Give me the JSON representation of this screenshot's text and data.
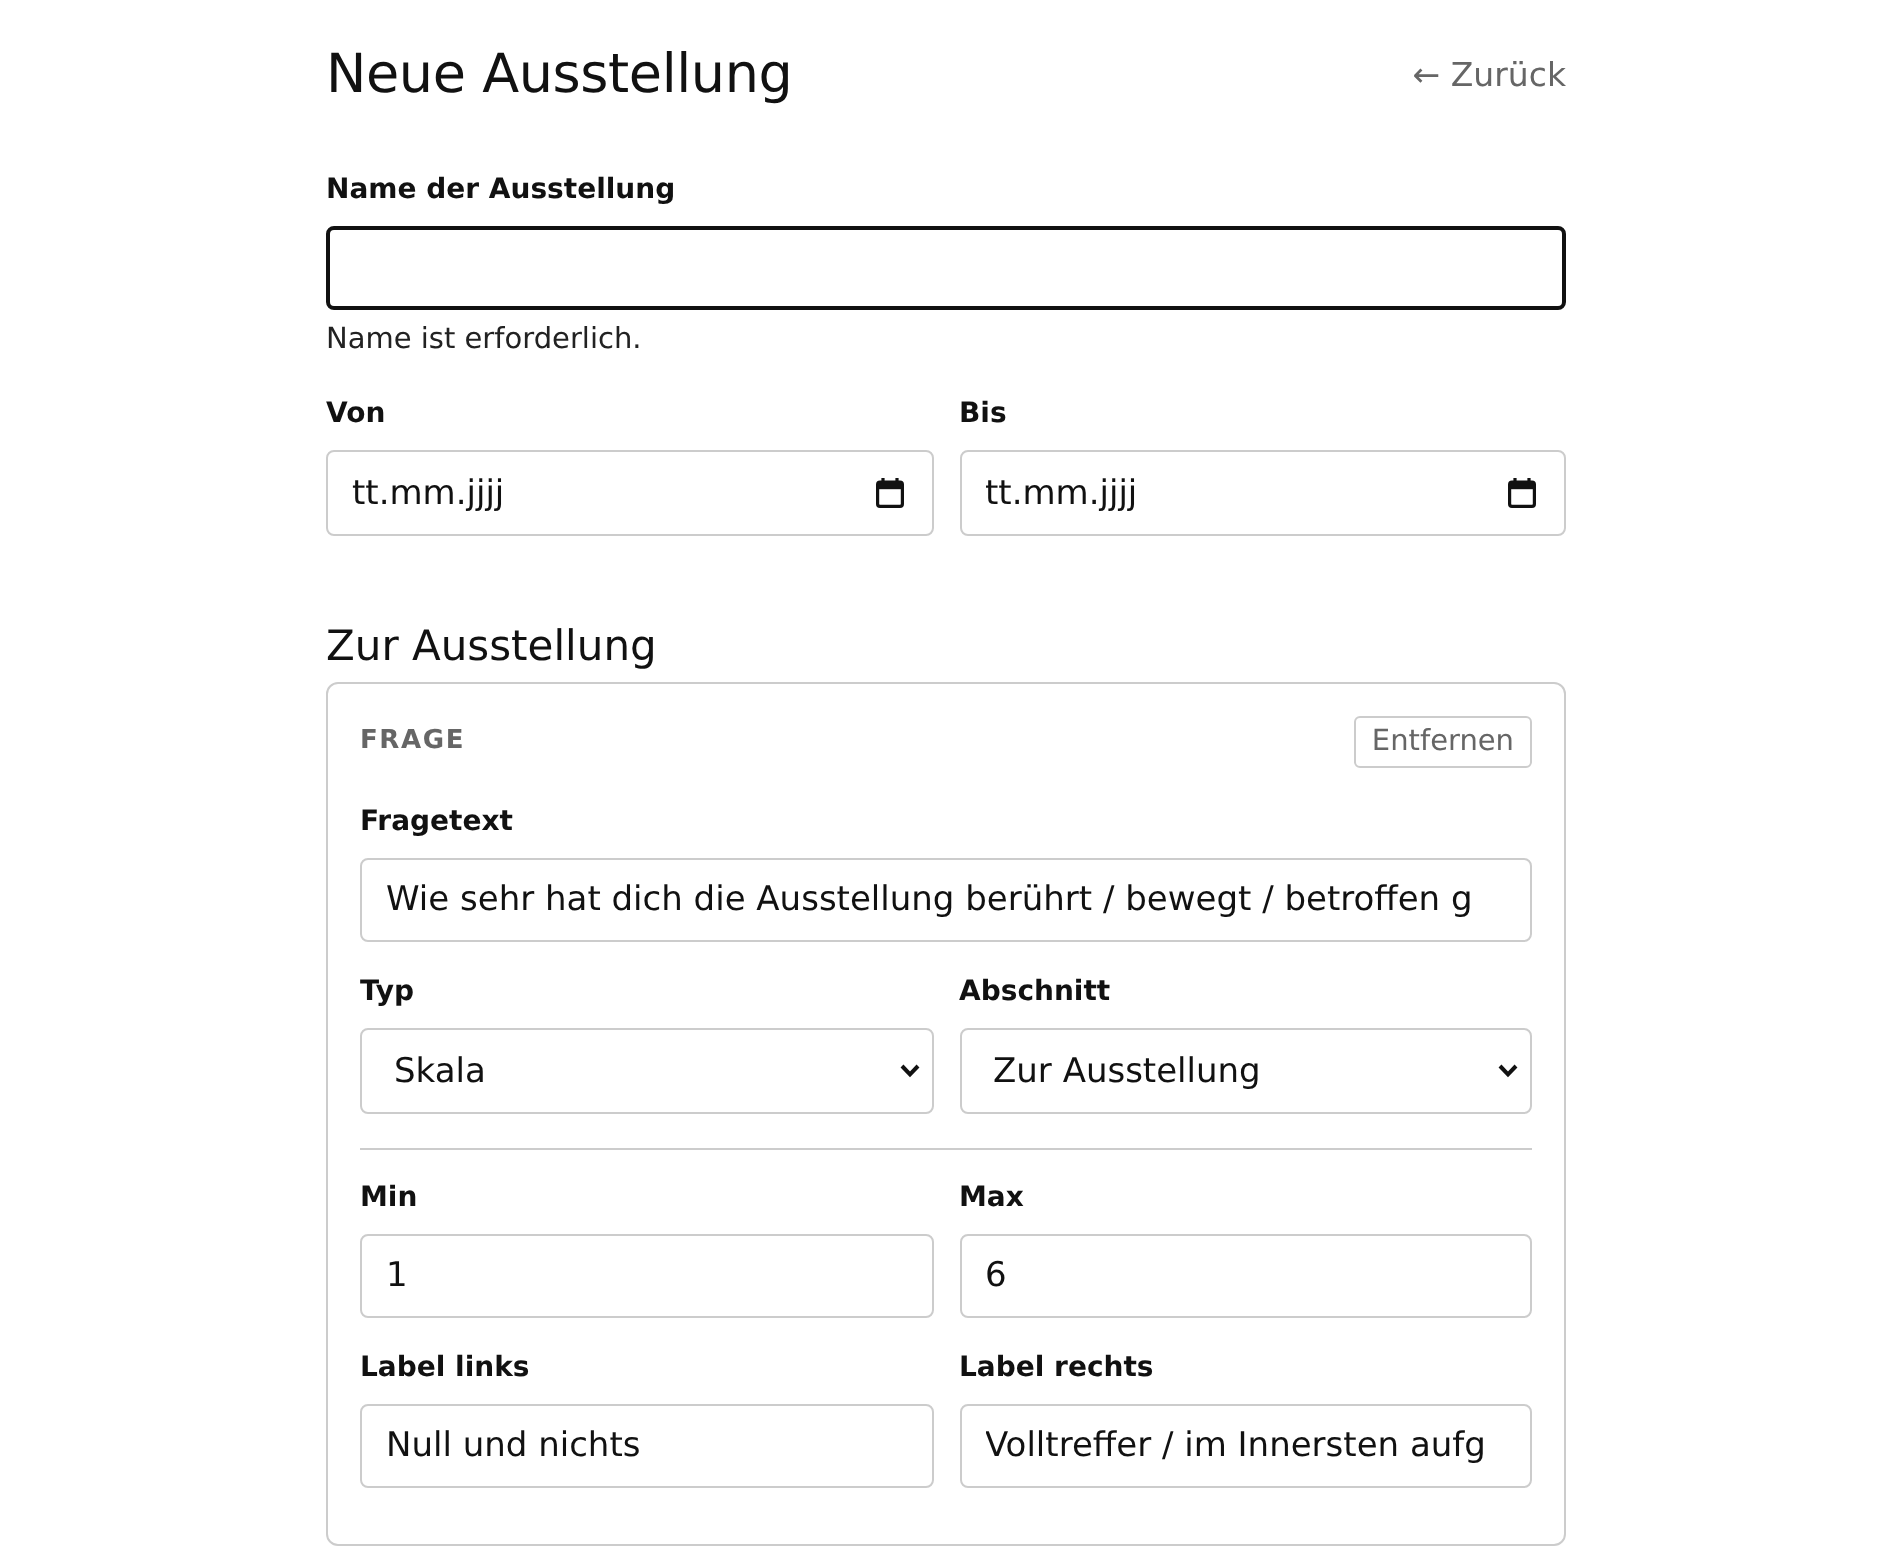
{
  "header": {
    "title": "Neue Ausstellung",
    "back_link": "← Zurück"
  },
  "name_field": {
    "label": "Name der Ausstellung",
    "kind": "text",
    "focused": true,
    "error": "Name ist erforderlich."
  },
  "date_fields": [
    {
      "label": "Von",
      "kind": "date",
      "placeholder": "tt.mm.jjjj"
    },
    {
      "label": "Bis",
      "kind": "date",
      "placeholder": "tt.mm.jjjj"
    }
  ],
  "section": {
    "title": "Zur Ausstellung",
    "question": {
      "heading": "FRAGE",
      "remove_button": "Entfernen",
      "question_text": {
        "label": "Fragetext",
        "kind": "text",
        "value": "Wie sehr hat dich die Ausstellung berührt / bewegt / betroffen g"
      },
      "settings": [
        {
          "label": "Typ",
          "kind": "select",
          "value": "Skala"
        },
        {
          "label": "Abschnitt",
          "kind": "select",
          "value": "Zur Ausstellung"
        }
      ],
      "scale_fields": [
        {
          "label": "Min",
          "kind": "text",
          "value": "1"
        },
        {
          "label": "Max",
          "kind": "text",
          "value": "6"
        },
        {
          "label": "Label links",
          "kind": "text",
          "value": "Null und nichts"
        },
        {
          "label": "Label rechts",
          "kind": "text",
          "value": "Volltreffer / im Innersten aufg"
        }
      ]
    }
  }
}
